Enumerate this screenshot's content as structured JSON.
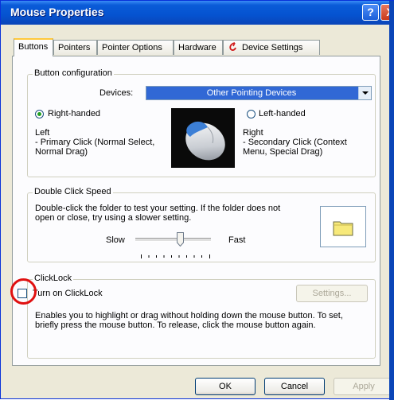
{
  "window": {
    "title": "Mouse Properties",
    "help_label": "?",
    "close_label": "X"
  },
  "tabs": [
    {
      "label": "Buttons",
      "active": true
    },
    {
      "label": "Pointers",
      "active": false
    },
    {
      "label": "Pointer Options",
      "active": false
    },
    {
      "label": "Hardware",
      "active": false
    },
    {
      "label": "Device Settings",
      "active": false
    }
  ],
  "button_config": {
    "group_title": "Button configuration",
    "devices_label": "Devices:",
    "devices_value": "Other Pointing Devices",
    "right_handed_label": "Right-handed",
    "left_handed_label": "Left-handed",
    "left_title": "Left",
    "left_desc_1": " - Primary Click (Normal Select,",
    "left_desc_2": "Normal Drag)",
    "right_title": "Right",
    "right_desc_1": " - Secondary Click (Context",
    "right_desc_2": "Menu, Special Drag)",
    "selected": "right-handed"
  },
  "double_click": {
    "group_title": "Double Click Speed",
    "text_1": "Double-click the folder to test your setting.  If the folder does not",
    "text_2": "open or close, try using a slower setting.",
    "slow_label": "Slow",
    "fast_label": "Fast",
    "speed_fraction": 0.6
  },
  "clicklock": {
    "group_title": "ClickLock",
    "checkbox_label": "Turn on ClickLock",
    "checked": false,
    "settings_label": "Settings...",
    "desc_1": "Enables you to highlight or drag without holding down the mouse button.  To set,",
    "desc_2": "briefly press the mouse button.  To release, click the mouse button again."
  },
  "footer": {
    "ok_label": "OK",
    "cancel_label": "Cancel",
    "apply_label": "Apply"
  },
  "colors": {
    "title_bar": "#0553d0",
    "accent_tab": "#ffc83c",
    "selection": "#3168d5",
    "annotation": "#e01010"
  }
}
